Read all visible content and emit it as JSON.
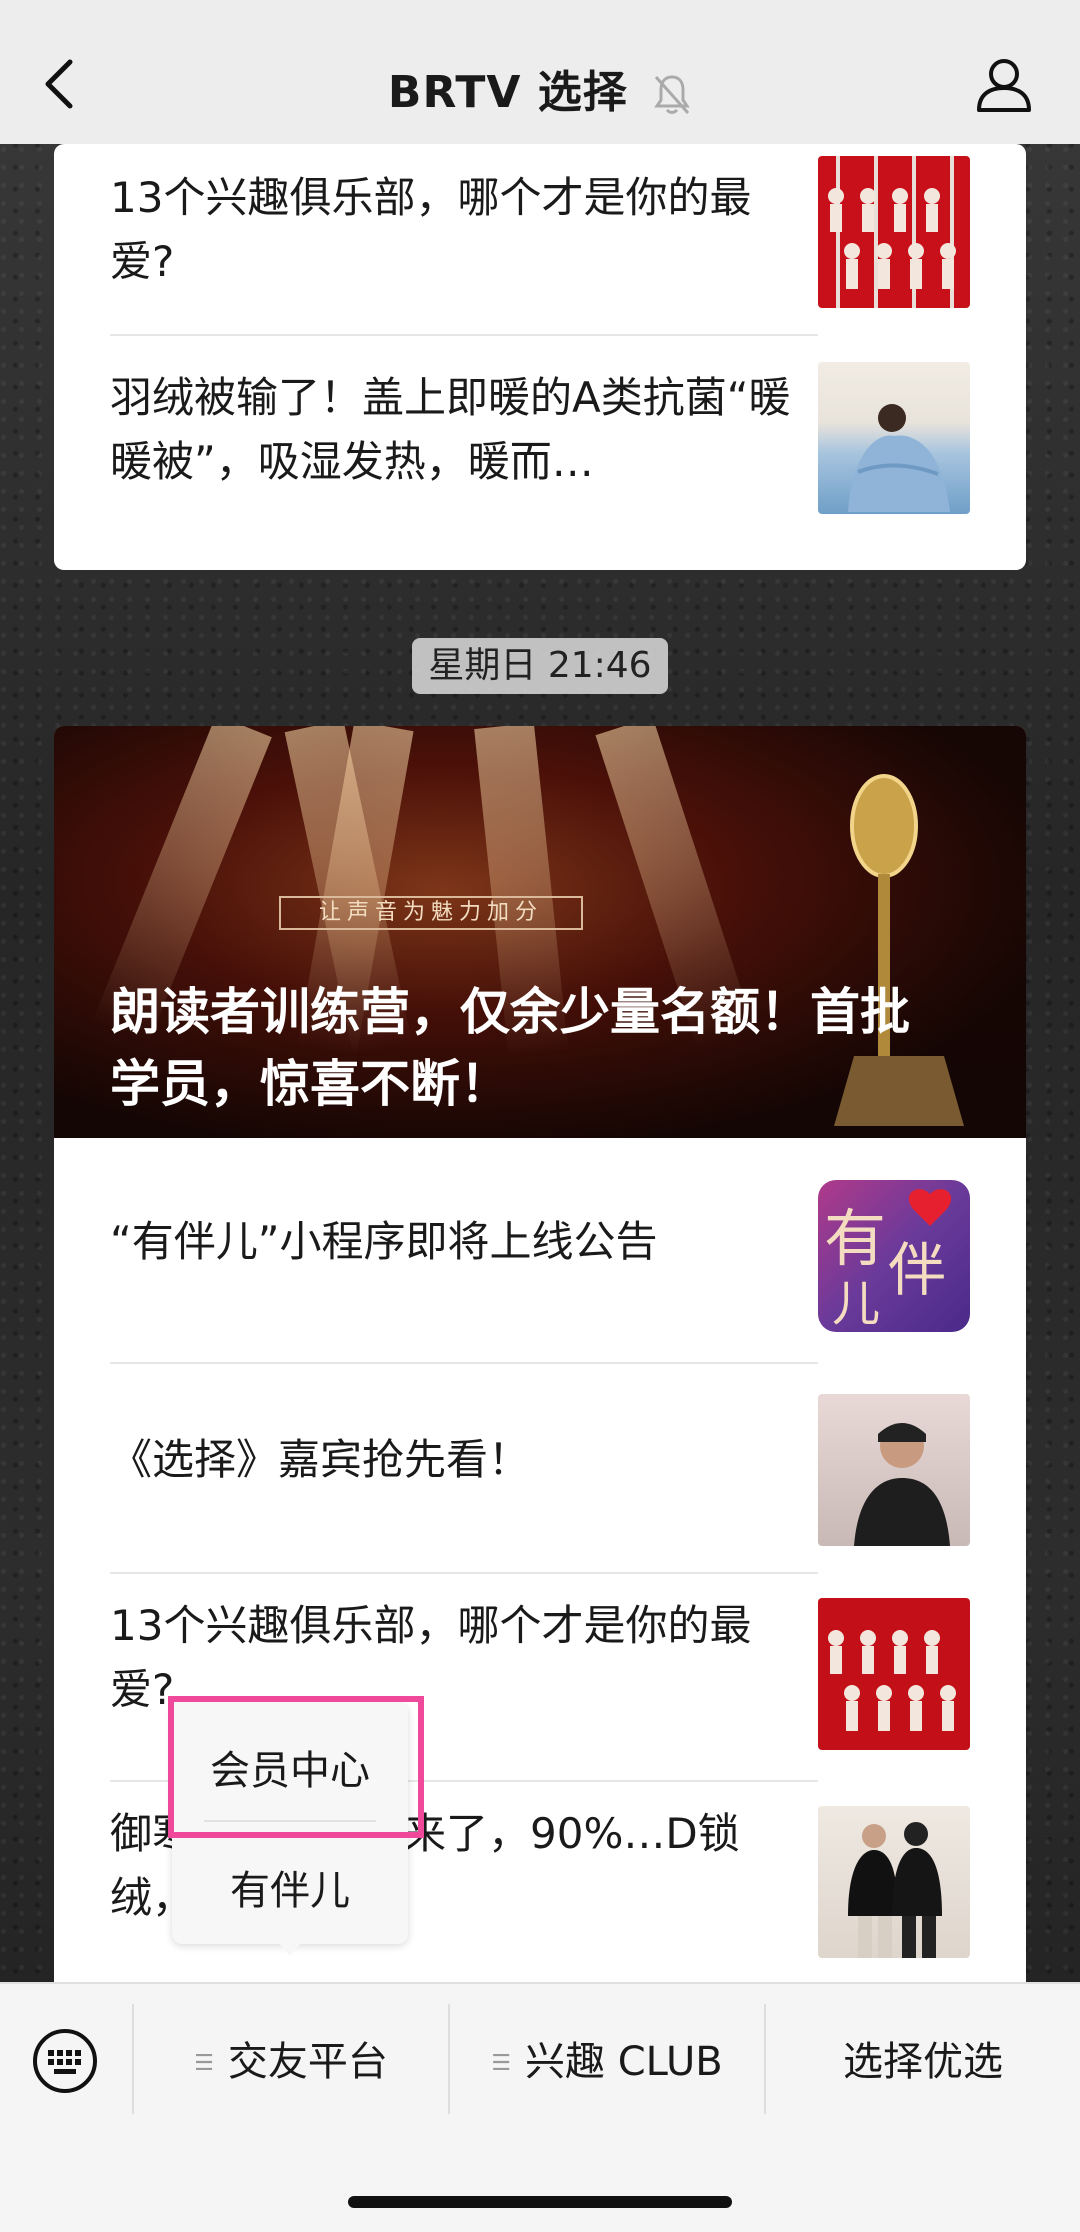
{
  "header": {
    "title": "BRTV 选择"
  },
  "top_card": {
    "items": [
      {
        "text": "13个兴趣俱乐部，哪个才是你的最爱?",
        "thumb": "red-paper-dolls"
      },
      {
        "text": "羽绒被输了！盖上即暖的A类抗菌“暖暖被”，吸湿发热，暖而…",
        "thumb": "blue-quilt"
      }
    ]
  },
  "timestamp": "星期日 21:46",
  "main_card": {
    "hero": {
      "banner": "让声音为魅力加分",
      "title": "朗读者训练营，仅余少量名额！首批学员，惊喜不断！"
    },
    "items": [
      {
        "text": "“有伴儿”小程序即将上线公告",
        "thumb": "youbanr-logo"
      },
      {
        "text": "《选择》嘉宾抢先看！",
        "thumb": "guest-photo"
      },
      {
        "text": "13个兴趣俱乐部，哪个才是你的最爱?",
        "thumb": "red-paper-dolls"
      },
      {
        "text": "御寒…金鹅绒服来了，90%…D锁绒，防水防…",
        "thumb": "couple-down-jackets"
      }
    ]
  },
  "popup": {
    "items": [
      "会员中心",
      "有伴儿"
    ]
  },
  "bottom_menu": {
    "items": [
      "交友平台",
      "兴趣 CLUB",
      "选择优选"
    ]
  },
  "colors": {
    "highlight": "#f0499c",
    "header_bg": "#ededed"
  }
}
